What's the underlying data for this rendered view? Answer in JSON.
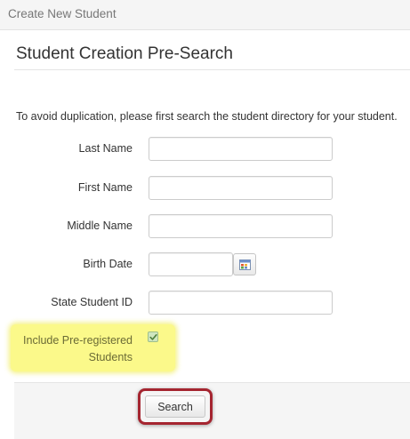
{
  "topbar": {
    "title": "Create New Student"
  },
  "page": {
    "title": "Student Creation Pre-Search",
    "intro": "To avoid duplication, please first search the student directory for your student."
  },
  "form": {
    "last_name": {
      "label": "Last Name",
      "value": ""
    },
    "first_name": {
      "label": "First Name",
      "value": ""
    },
    "middle_name": {
      "label": "Middle Name",
      "value": ""
    },
    "birth_date": {
      "label": "Birth Date",
      "value": ""
    },
    "state_student_id": {
      "label": "State Student ID",
      "value": ""
    },
    "include_preregistered": {
      "label_line1": "Include Pre-registered",
      "label_line2": "Students",
      "checked": true
    }
  },
  "actions": {
    "search_label": "Search"
  },
  "icons": {
    "calendar": "calendar-icon",
    "checkmark": "check-icon"
  },
  "colors": {
    "highlight": "#fbf98a",
    "callout_border": "#a52530",
    "checkbox_fill": "#cfe6bf"
  }
}
